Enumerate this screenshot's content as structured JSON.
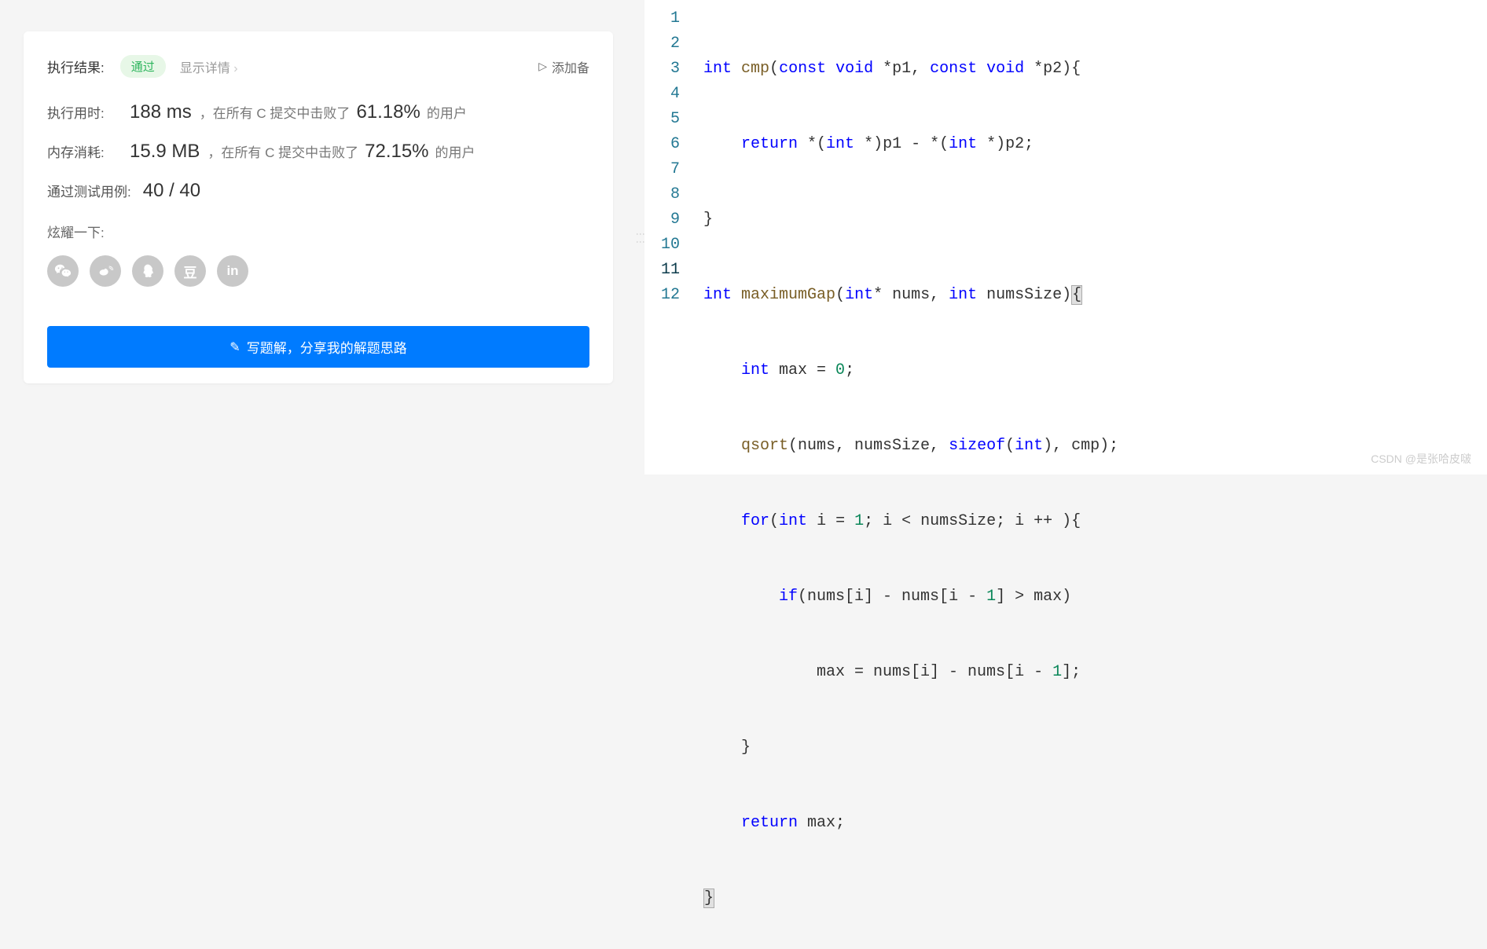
{
  "result": {
    "label": "执行结果:",
    "status": "通过",
    "show_details": "显示详情",
    "add_note": "添加备",
    "runtime": {
      "label": "执行用时:",
      "value": "188 ms",
      "desc_prefix": "，在所有 C 提交中击败了",
      "percent": "61.18%",
      "desc_suffix": "的用户"
    },
    "memory": {
      "label": "内存消耗:",
      "value": "15.9 MB",
      "desc_prefix": "，在所有 C 提交中击败了",
      "percent": "72.15%",
      "desc_suffix": "的用户"
    },
    "testcases": {
      "label": "通过测试用例:",
      "value": "40 / 40"
    },
    "show_off": "炫耀一下:",
    "share": {
      "wechat": "wechat-icon",
      "weibo": "weibo-icon",
      "qq": "qq-icon",
      "douban": "豆",
      "linkedin": "in"
    },
    "button": "写题解，分享我的解题思路"
  },
  "code": {
    "current_line": 11,
    "lines": [
      "int cmp(const void *p1, const void *p2){",
      "    return *(int *)p1 - *(int *)p2;",
      "}",
      "int maximumGap(int* nums, int numsSize){",
      "    int max = 0;",
      "    qsort(nums, numsSize, sizeof(int), cmp);",
      "    for(int i = 1; i < numsSize; i ++ ){",
      "        if(nums[i] - nums[i - 1] > max)",
      "            max = nums[i] - nums[i - 1];",
      "    }",
      "    return max;",
      "}"
    ]
  },
  "watermark": "CSDN @是张哈皮啵"
}
